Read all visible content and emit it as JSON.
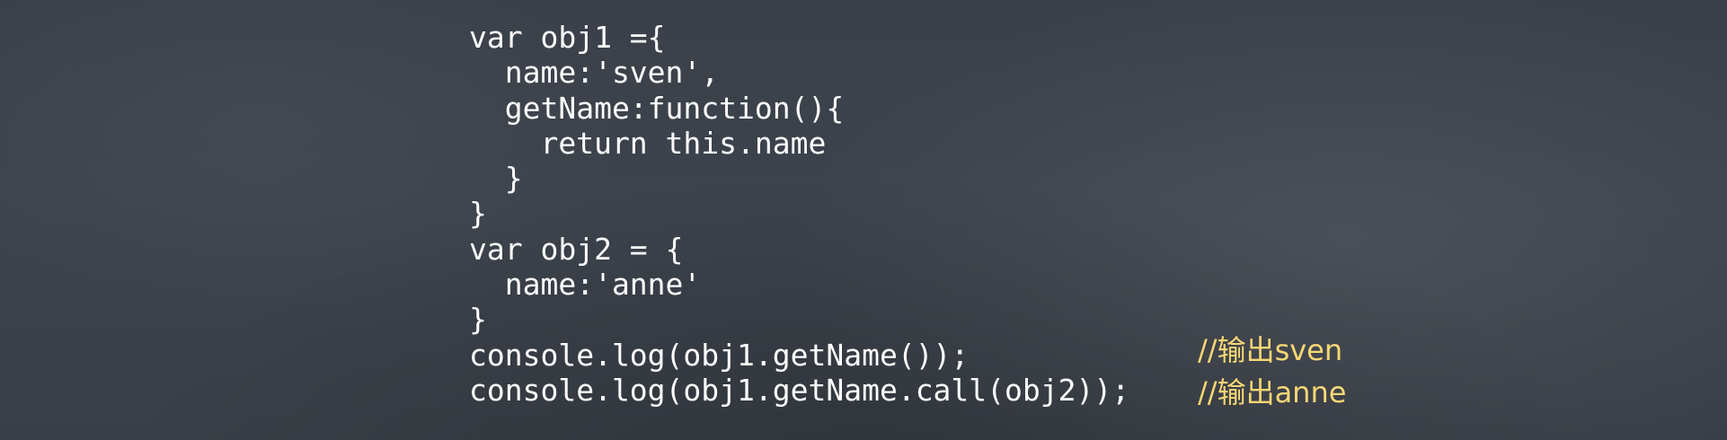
{
  "slide": {
    "code_lines": [
      "var obj1 ={",
      "  name:'sven',",
      "  getName:function(){",
      "    return this.name",
      "  }",
      "}",
      "var obj2 = {",
      "  name:'anne'",
      "}",
      "console.log(obj1.getName());",
      "console.log(obj1.getName.call(obj2));"
    ],
    "comments": [
      "//输出sven",
      "//输出anne"
    ],
    "colors": {
      "background": "#3a3f48",
      "code_text": "#ffffff",
      "comment_text": "#f6d774"
    }
  }
}
